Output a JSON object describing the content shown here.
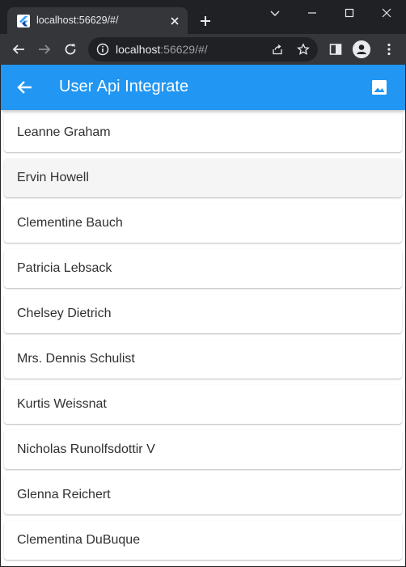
{
  "browser": {
    "tab_title": "localhost:56629/#/",
    "url_host": "localhost",
    "url_rest": ":56629/#/"
  },
  "icons": {
    "favicon": "flutter-icon",
    "tab_close": "close-icon",
    "new_tab": "plus-icon",
    "minimize": "minimize-icon",
    "maximize": "maximize-icon",
    "close_window": "close-icon",
    "chevron": "chevron-down-icon",
    "back": "arrow-left-icon",
    "forward": "arrow-right-icon",
    "reload": "reload-icon",
    "site_info": "info-icon",
    "share": "share-icon",
    "bookmark": "star-icon",
    "side_panel": "side-panel-icon",
    "profile": "profile-icon",
    "menu": "kebab-menu-icon",
    "app_back": "arrow-left-icon",
    "app_action": "image-icon"
  },
  "colors": {
    "appbar": "#2196f3",
    "chrome_dark": "#202124",
    "chrome_toolbar": "#35363a"
  },
  "appbar": {
    "title": "User Api Integrate"
  },
  "users": [
    {
      "name": "Leanne Graham"
    },
    {
      "name": "Ervin Howell"
    },
    {
      "name": "Clementine Bauch"
    },
    {
      "name": "Patricia Lebsack"
    },
    {
      "name": "Chelsey Dietrich"
    },
    {
      "name": "Mrs. Dennis Schulist"
    },
    {
      "name": "Kurtis Weissnat"
    },
    {
      "name": "Nicholas Runolfsdottir V"
    },
    {
      "name": "Glenna Reichert"
    },
    {
      "name": "Clementina DuBuque"
    }
  ]
}
